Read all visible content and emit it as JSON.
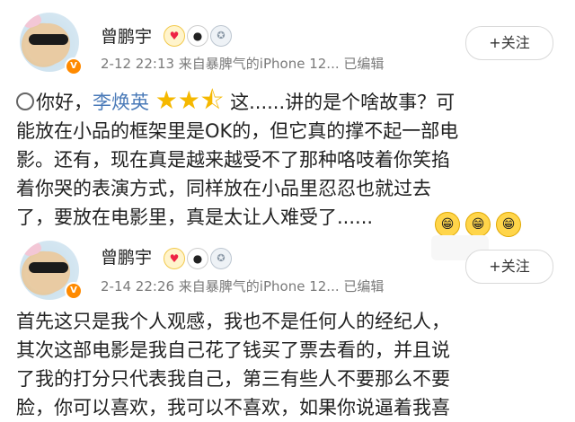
{
  "post1": {
    "username": "曾鹏宇",
    "verified_badge": "V",
    "badges": [
      "heart-badge",
      "panda-badge",
      "medal-badge"
    ],
    "meta": "2-12 22:13  来自暴脾气的iPhone 12...  已编辑",
    "follow_label": "+关注",
    "text": {
      "emoji": "smile-icon",
      "greeting": "你好，",
      "mention": "李焕英",
      "rating_stars": 2.5,
      "stars": "★★",
      "half_star": "⯪",
      "line1_tail": " 这......讲的是个啥故事？可",
      "line2": "能放在小品的框架里是OK的，但它真的撑不起一部电",
      "line3": "影。还有，现在真是越来越受不了那种咯吱着你笑掐",
      "line4": "着你哭的表演方式，同样放在小品里忍忍也就过去",
      "line5": "了，要放在电影里，真是太让人难受了......"
    },
    "trailing_emojis": [
      "😁",
      "😁",
      "😁"
    ]
  },
  "post2": {
    "username": "曾鹏宇",
    "verified_badge": "V",
    "badges": [
      "heart-badge",
      "panda-badge",
      "medal-badge"
    ],
    "meta": "2-14 22:26  来自暴脾气的iPhone 12...  已编辑",
    "follow_label": "+关注",
    "sticker": "sticker",
    "text": {
      "line1": "首先这只是我个人观感，我也不是任何人的经纪人，",
      "line2": "其次这部电影是我自己花了钱买了票去看的，并且说",
      "line3": "了我的打分只代表我自己，第三有些人不要那么不要",
      "line4": "脸，你可以喜欢，我可以不喜欢，如果你说逼着我喜"
    }
  }
}
